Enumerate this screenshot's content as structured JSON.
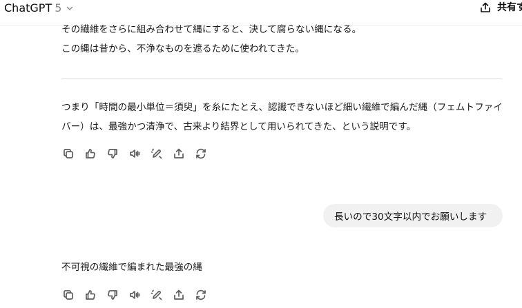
{
  "header": {
    "model_name": "ChatGPT",
    "model_version": "5",
    "share_label": "共有す"
  },
  "assistant_prev": {
    "line1": "その繊維をさらに組み合わせて縄にすると、決して腐らない縄になる。",
    "line2": "この縄は昔から、不浄なものを遮るために使われてきた。"
  },
  "assistant_summary": {
    "line1": "つまり「時間の最小単位＝須臾」を糸にたとえ、認識できないほど細い繊維で編んだ縄（フェムトファイ",
    "line2": "バー）は、最強かつ清浄で、古来より結界として用いられてきた、という説明です。"
  },
  "user_message": {
    "text": "長いので30文字以内でお願いします"
  },
  "assistant_reply": {
    "text": "不可視の繊維で編まれた最強の縄"
  },
  "action_icons": [
    "copy-icon",
    "thumbs-up-icon",
    "thumbs-down-icon",
    "read-aloud-icon",
    "edit-icon",
    "share-icon",
    "regenerate-icon"
  ]
}
